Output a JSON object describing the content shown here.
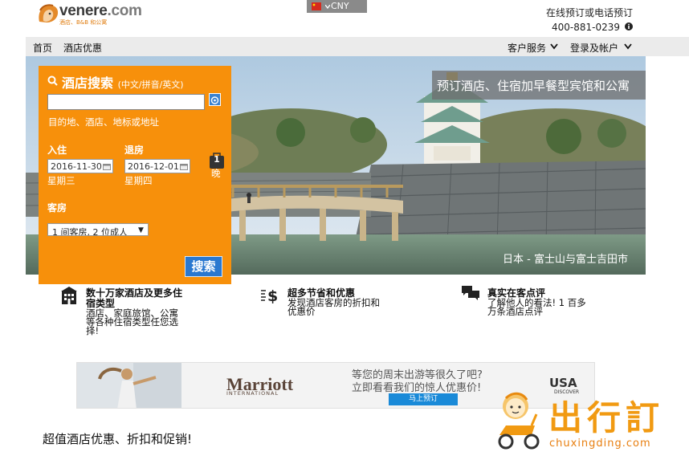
{
  "header": {
    "logo_text": "venere",
    "logo_tld": ".com",
    "logo_tagline": "酒店、B&B 和公寓",
    "currency": "CNY",
    "phone_label": "在线预订或电话预订",
    "phone_number": "400-881-0239"
  },
  "nav": {
    "home": "首页",
    "hotel_deals": "酒店优惠",
    "customer_service": "客户服务",
    "login": "登录及帐户"
  },
  "hero": {
    "caption": "预订酒店、住宿加早餐型宾馆和公寓",
    "credit": "日本 - 富士山与富士吉田市"
  },
  "search": {
    "title": "酒店搜索",
    "title_hint": "(中文/拼音/英文)",
    "input_value": "",
    "hint": "目的地、酒店、地标或地址",
    "checkin_label": "入住",
    "checkout_label": "退房",
    "checkin_date": "2016-11-30",
    "checkout_date": "2016-12-01",
    "checkin_weekday": "星期三",
    "checkout_weekday": "星期四",
    "nights_count": "1",
    "nights_label": "晚",
    "rooms_label": "客房",
    "rooms_value": "1 间客房, 2 位成人",
    "button": "搜索"
  },
  "features": [
    {
      "icon": "building-icon",
      "title_1": "数十万家酒店及更多住",
      "title_2": "宿类型",
      "desc_1": "酒店、家庭旅馆、公寓",
      "desc_2": "等各种住宿类型任您选",
      "desc_3": "择!"
    },
    {
      "icon": "dollar-icon",
      "title_1": "超多节省和优惠",
      "desc_1": "发现酒店客房的折扣和",
      "desc_2": "优惠价"
    },
    {
      "icon": "chat-icon",
      "title_1": "真实在客点评",
      "desc_1": "了解他人的看法! 1 百多",
      "desc_2": "万条酒店点评"
    }
  ],
  "ad": {
    "brand": "Marriott",
    "brand_sub": "INTERNATIONAL",
    "line1": "等您的周末出游等很久了吧?",
    "line2": "立即看看我们的惊人优惠价!",
    "button": "马上预订",
    "usa": "USA",
    "usa_sub": "DISCOVER"
  },
  "section_title": "超值酒店优惠、折扣和促销!",
  "watermark": {
    "text": "出行訂",
    "url": "chuxingding.com"
  },
  "colors": {
    "orange": "#f7900b",
    "blue": "#2a78d0",
    "nav_bg": "#ebebeb"
  }
}
